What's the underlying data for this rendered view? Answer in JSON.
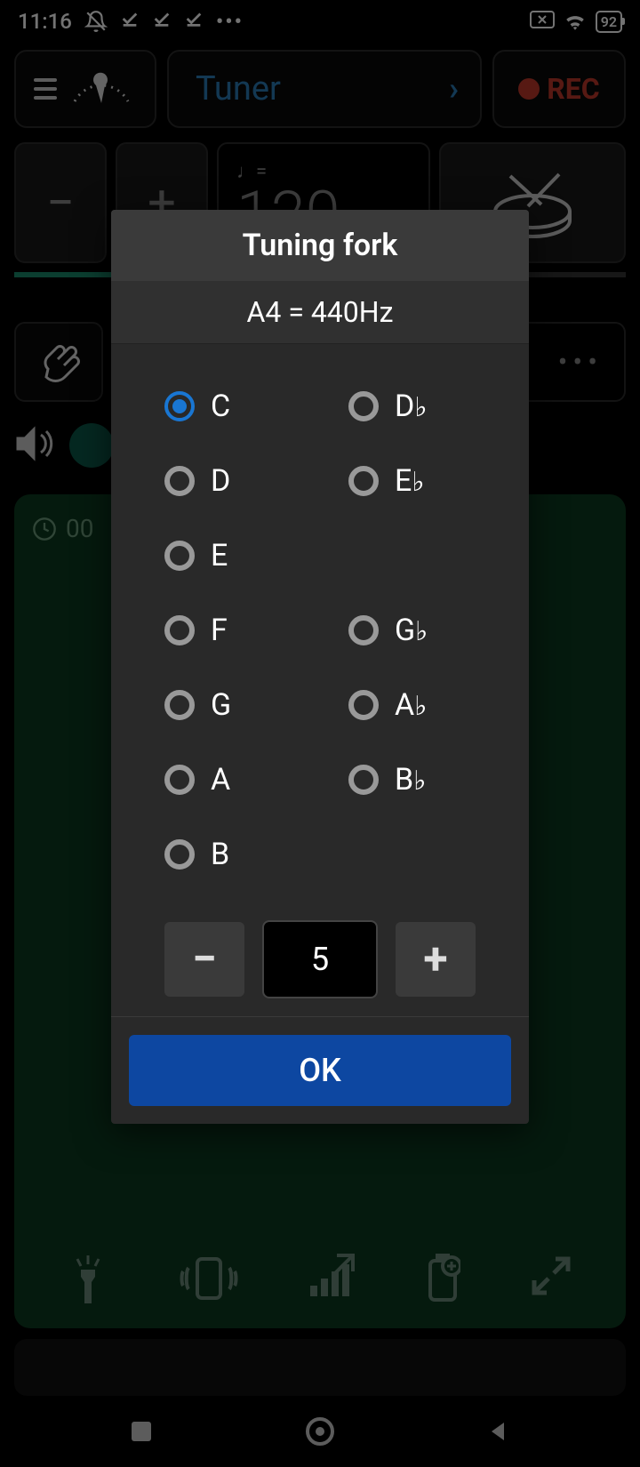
{
  "status": {
    "time": "11:16",
    "battery": "92"
  },
  "top": {
    "tuner_label": "Tuner",
    "rec_label": "REC"
  },
  "tempo": {
    "note_equals": "♩=",
    "value": "120"
  },
  "timer": {
    "text": "00"
  },
  "dialog": {
    "title": "Tuning fork",
    "subtitle": "A4 = 440Hz",
    "left_notes": [
      "C",
      "D",
      "E",
      "F",
      "G",
      "A",
      "B"
    ],
    "right_notes": [
      "D♭",
      "E♭",
      "",
      "G♭",
      "A♭",
      "B♭"
    ],
    "selected": "C",
    "stepper_value": "5",
    "ok_label": "OK"
  }
}
